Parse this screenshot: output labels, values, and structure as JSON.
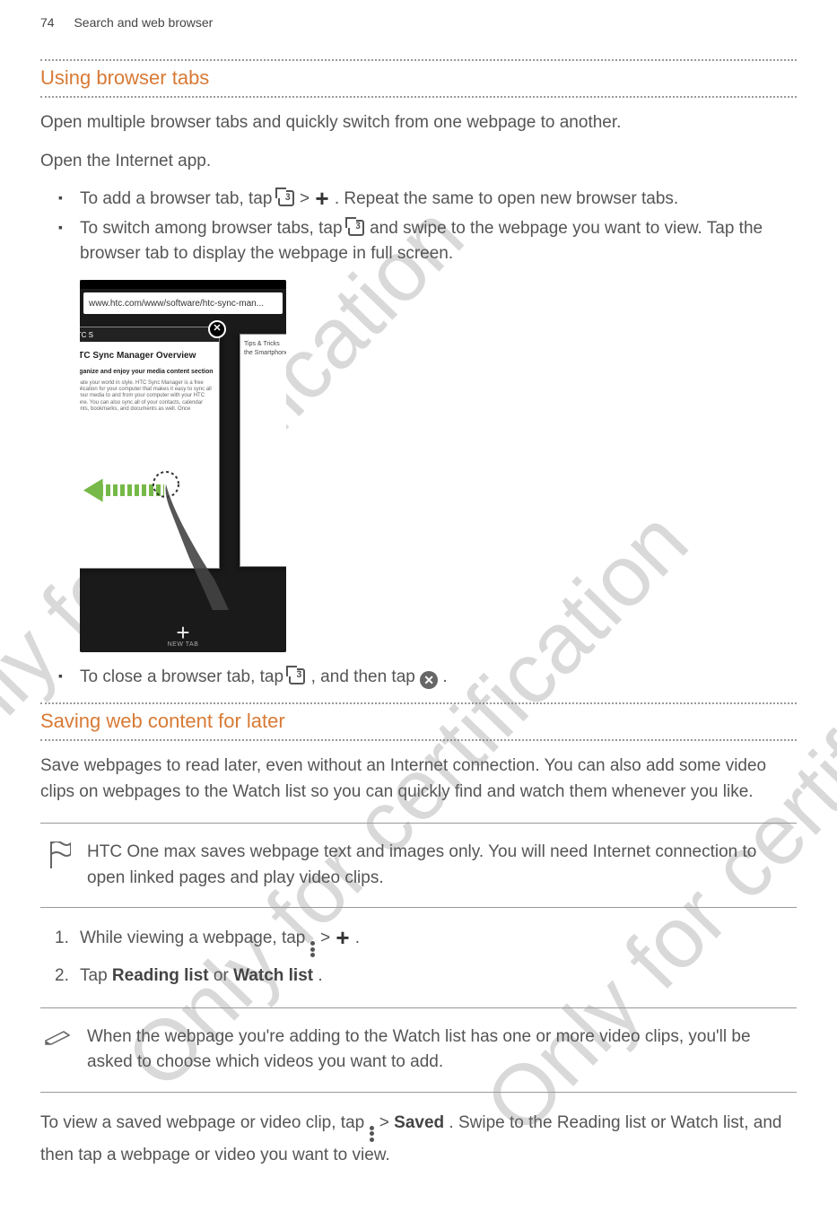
{
  "header": {
    "page_num": "74",
    "chapter": "Search and web browser"
  },
  "watermark": "Only for certification",
  "section1": {
    "title": "Using browser tabs",
    "intro": "Open multiple browser tabs and quickly switch from one webpage to another.",
    "open_app": "Open the Internet app.",
    "bullets": {
      "b1_pre": "To add a browser tab, tap ",
      "b1_mid": " > ",
      "b1_post": ". Repeat the same to open new browser tabs.",
      "b2_pre": "To switch among browser tabs, tap ",
      "b2_post": " and swipe to the webpage you want to view. Tap the browser tab to display the webpage in full screen.",
      "b3_pre": "To close a browser tab, tap ",
      "b3_mid": ", and then tap ",
      "b3_post": "."
    },
    "tabs_badge": "3",
    "phone": {
      "url": "www.htc.com/www/software/htc-sync-man...",
      "card_title": "HTC Sync Manager Overview",
      "card_sub": "Organize and enjoy your media content section",
      "card_body": "Create your world in style. HTC Sync Manager is a free application for your computer that makes it easy to sync all of your media to and from your computer with your HTC phone. You can also sync all of your contacts, calendar events, bookmarks, and documents as well. Once",
      "card2_title": "Tips & Tricks the Smartphone",
      "bar_text": "HTC S",
      "new_tab": "NEW TAB"
    }
  },
  "section2": {
    "title": "Saving web content for later",
    "intro": "Save webpages to read later, even without an Internet connection. You can also add some video clips on webpages to the Watch list so you can quickly find and watch them whenever you like.",
    "note1": "HTC One max saves webpage text and images only. You will need Internet connection to open linked pages and play video clips.",
    "steps": {
      "s1_pre": "While viewing a webpage, tap ",
      "s1_mid": " > ",
      "s1_post": ".",
      "s2_pre": "Tap ",
      "s2_b1": "Reading list",
      "s2_mid": " or ",
      "s2_b2": "Watch list",
      "s2_post": "."
    },
    "note2": "When the webpage you're adding to the Watch list has one or more video clips, you'll be asked to choose which videos you want to add.",
    "outro_pre": "To view a saved webpage or video clip, tap ",
    "outro_mid": " > ",
    "outro_bold": "Saved",
    "outro_post": ". Swipe to the Reading list or Watch list, and then tap a webpage or video you want to view."
  }
}
